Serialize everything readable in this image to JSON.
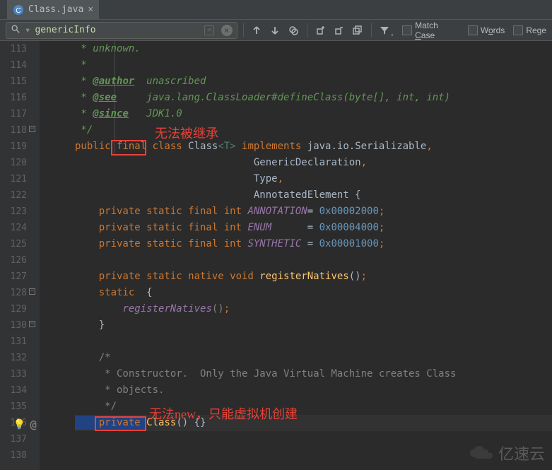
{
  "tab": {
    "filename": "Class.java"
  },
  "search": {
    "value": "genericInfo"
  },
  "options": {
    "matchCase": "Match Case",
    "words": "Words",
    "regex": "Rege"
  },
  "lines": [
    "113",
    "114",
    "115",
    "116",
    "117",
    "118",
    "119",
    "120",
    "121",
    "122",
    "123",
    "124",
    "125",
    "126",
    "127",
    "128",
    "129",
    "130",
    "131",
    "132",
    "133",
    "134",
    "135",
    "136",
    "137",
    "138"
  ],
  "annotations": {
    "redLabel1": "无法被继承",
    "redLabel2": "无法new，只能虚拟机创建"
  },
  "code": {
    "l113": {
      "pre": " * ",
      "text": "unknown."
    },
    "l114": {
      "pre": " *"
    },
    "l115": {
      "pre": " * ",
      "tag": "@author",
      "rest": "  unascribed"
    },
    "l116": {
      "pre": " * ",
      "tag": "@see",
      "rest1": "     java.lang.ClassLoader",
      "rest2": "#defineClass(byte[], int, int)"
    },
    "l117": {
      "pre": " * ",
      "tag": "@since",
      "rest": "   JDK1.0"
    },
    "l118": {
      "pre": " */"
    },
    "l119": {
      "kw1": "public final class ",
      "name": "Class",
      "tp": "<T>",
      "kw2": " implements ",
      "intf1": "java.io.Serializable",
      "comma": ","
    },
    "l120": {
      "indent": "                              ",
      "name": "GenericDeclaration",
      "comma": ","
    },
    "l121": {
      "indent": "                              ",
      "name": "Type",
      "comma": ","
    },
    "l122": {
      "indent": "                              ",
      "name": "AnnotatedElement ",
      "brace": "{"
    },
    "l123": {
      "kw": "    private static final int ",
      "name": "ANNOTATION",
      "eq": "= ",
      "num": "0x00002000",
      "semi": ";"
    },
    "l124": {
      "kw": "    private static final int ",
      "name": "ENUM",
      "sp": "      ",
      "eq": "= ",
      "num": "0x00004000",
      "semi": ";"
    },
    "l125": {
      "kw": "    private static final int ",
      "name": "SYNTHETIC",
      "sp": " ",
      "eq": "= ",
      "num": "0x00001000",
      "semi": ";"
    },
    "l127": {
      "kw": "    private static native void ",
      "name": "registerNatives",
      "paren": "()",
      "semi": ";"
    },
    "l128": {
      "kw": "    static ",
      "brace": " {"
    },
    "l129": {
      "indent": "        ",
      "name": "registerNatives",
      "paren": "()",
      "semi": ";"
    },
    "l130": {
      "indent": "    ",
      "brace": "}"
    },
    "l132": {
      "txt": "    /*"
    },
    "l133": {
      "txt": "     * Constructor.  Only the Java Virtual Machine creates Class"
    },
    "l134": {
      "txt": "     * objects."
    },
    "l135": {
      "txt": "     */"
    },
    "l136": {
      "kw": "    private ",
      "name": "Class",
      "paren": "() ",
      "brace": "{}"
    }
  },
  "watermark": "亿速云"
}
